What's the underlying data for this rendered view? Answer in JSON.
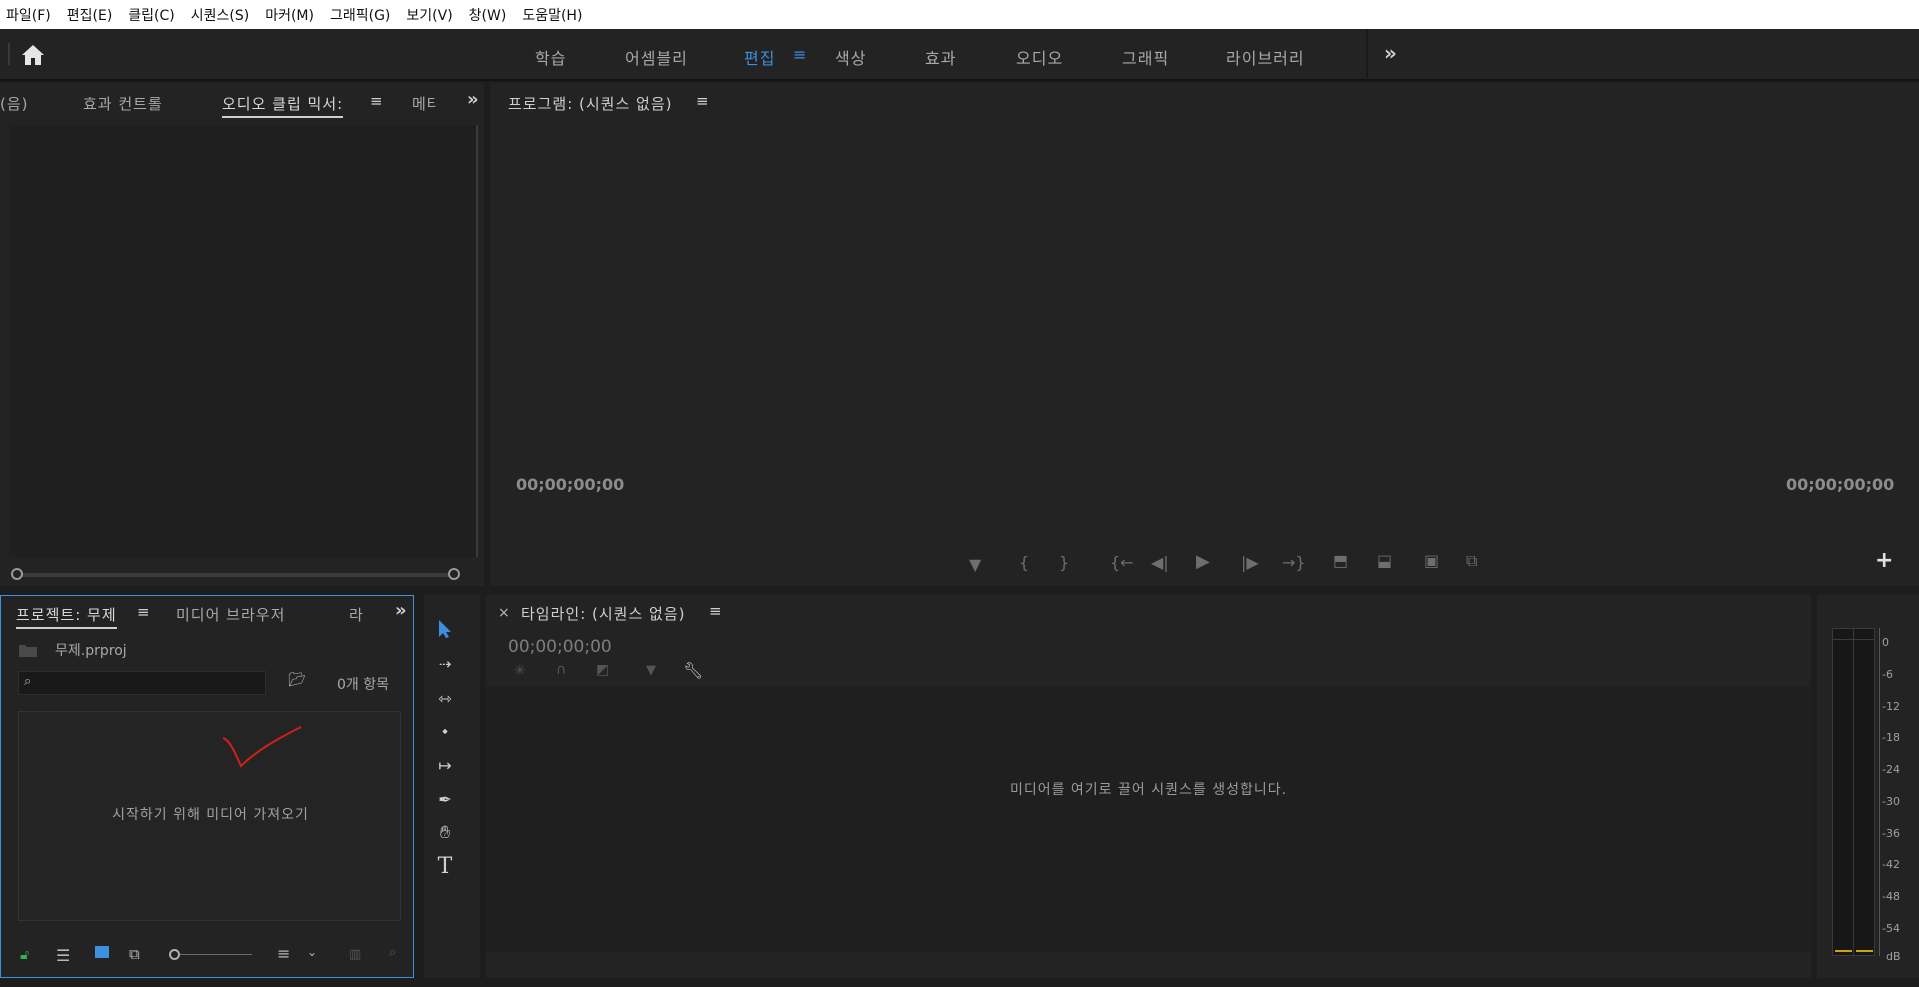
{
  "menubar": {
    "items": [
      "파일(F)",
      "편집(E)",
      "클립(C)",
      "시퀀스(S)",
      "마커(M)",
      "그래픽(G)",
      "보기(V)",
      "창(W)",
      "도움말(H)"
    ]
  },
  "workspaces": {
    "tabs": [
      "학습",
      "어셈블리",
      "편집",
      "색상",
      "효과",
      "오디오",
      "그래픽",
      "라이브러리"
    ],
    "active": "편집",
    "more_label": "»"
  },
  "source_panel": {
    "tabs": [
      "(음)",
      "효과 컨트롤",
      "오디오 클립 믹서:",
      "메타"
    ],
    "active_tab": "오디오 클립 믹서:"
  },
  "program_monitor": {
    "title": "프로그램: (시퀀스 없음)",
    "timecode_left": "00;00;00;00",
    "timecode_right": "00;00;00;00",
    "add_label": "+"
  },
  "project_panel": {
    "tabs": [
      "프로젝트: 무제",
      "미디어 브라우저",
      "라"
    ],
    "active_tab": "프로젝트: 무제",
    "file_name": "무제.prproj",
    "search_placeholder": "",
    "item_count": "0개 항목",
    "empty_message": "시작하기 위해 미디어 가져오기",
    "annotation_color": "#d0201a"
  },
  "timeline": {
    "close_label": "×",
    "title": "타임라인: (시퀀스 없음)",
    "timecode": "00;00;00;00",
    "empty_message": "미디어를 여기로 끌어 시퀀스를 생성합니다."
  },
  "audio_meter": {
    "scale": [
      "0",
      "-6",
      "-12",
      "-18",
      "-24",
      "-30",
      "-36",
      "-42",
      "-48",
      "-54",
      "dB"
    ]
  },
  "colors": {
    "accent": "#3d8fe0",
    "panel_bg": "#232323",
    "app_bg": "#1d1d1d",
    "lock_green": "#2fb34a"
  }
}
